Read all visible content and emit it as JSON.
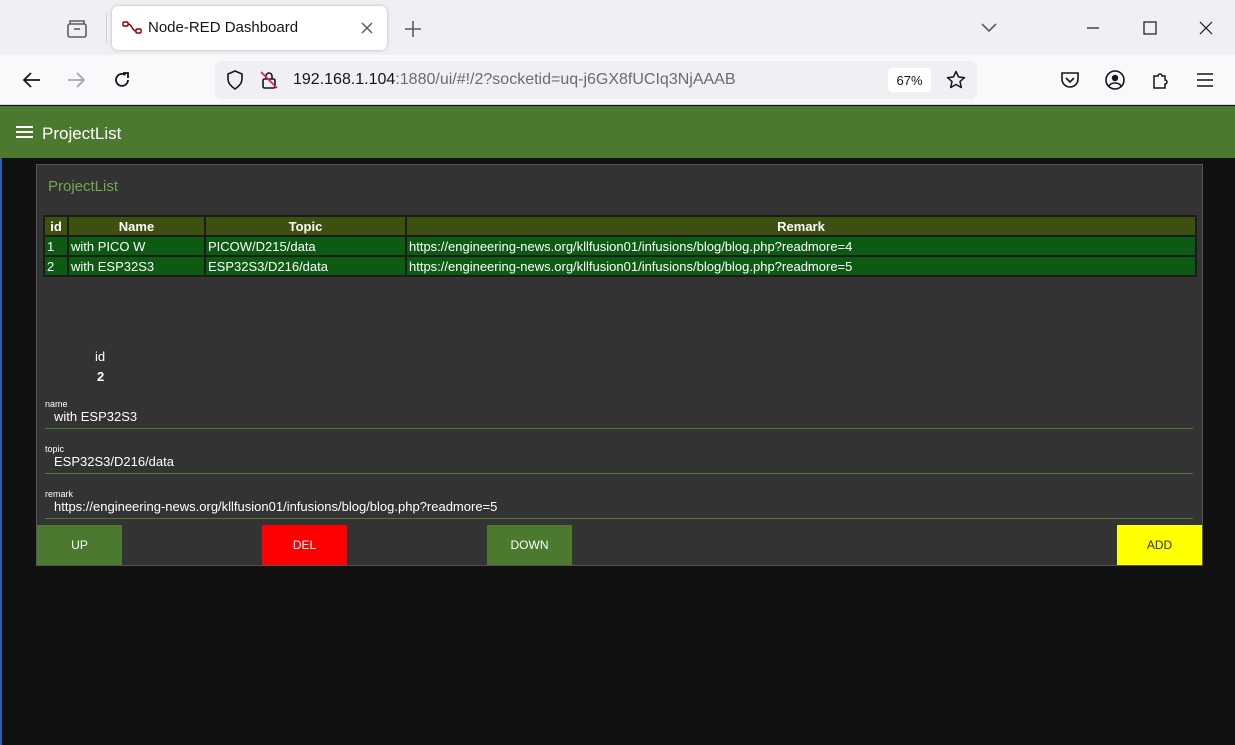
{
  "browser": {
    "tab_title": "Node-RED Dashboard",
    "url_host": "192.168.1.104",
    "url_rest": ":1880/ui/#!/2?socketid=uq-j6GX8fUCIq3NjAAAB",
    "zoom": "67%"
  },
  "dashboard": {
    "toolbar_title": "ProjectList",
    "card_title": "ProjectList",
    "table": {
      "headers": [
        "id",
        "Name",
        "Topic",
        "Remark"
      ],
      "rows": [
        [
          "1",
          "with PICO W",
          "PICOW/D215/data",
          "https://engineering-news.org/kllfusion01/infusions/blog/blog.php?readmore=4"
        ],
        [
          "2",
          "with ESP32S3",
          "ESP32S3/D216/data",
          "https://engineering-news.org/kllfusion01/infusions/blog/blog.php?readmore=5"
        ]
      ]
    },
    "form": {
      "id_label": "id",
      "id_value": "2",
      "name_label": "name",
      "name_value": "with ESP32S3",
      "topic_label": "topic",
      "topic_value": "ESP32S3/D216/data",
      "remark_label": "remark",
      "remark_value": "https://engineering-news.org/kllfusion01/infusions/blog/blog.php?readmore=5"
    },
    "buttons": {
      "up": "UP",
      "del": "DEL",
      "down": "DOWN",
      "add": "ADD"
    }
  },
  "colors": {
    "toolbar": "#4b7930",
    "table_header": "#3d5010",
    "table_row": "#0d5a13",
    "up_button": "#4b7930",
    "del_button": "#ff0000",
    "down_button": "#4b7930",
    "add_button": "#ffff00"
  }
}
